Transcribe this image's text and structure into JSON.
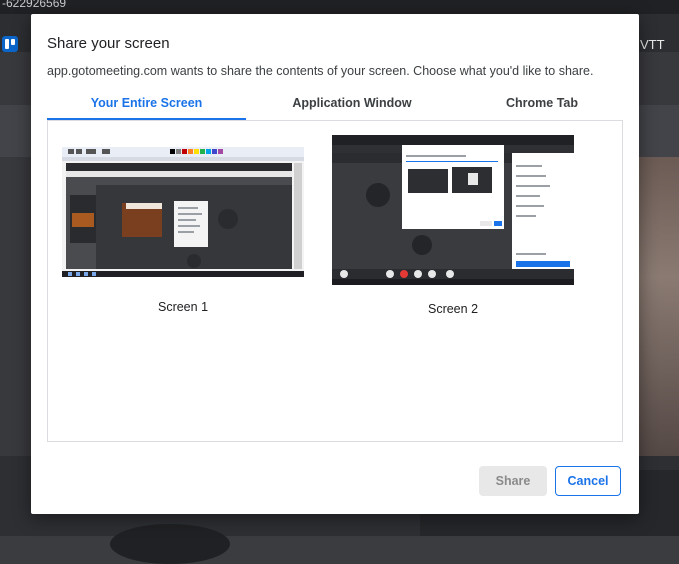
{
  "background": {
    "phone_text": "-622926569",
    "app_label": "VTT"
  },
  "dialog": {
    "title": "Share your screen",
    "subtitle": "app.gotomeeting.com wants to share the contents of your screen. Choose what you'd like to share.",
    "tabs": [
      {
        "label": "Your Entire Screen",
        "active": true
      },
      {
        "label": "Application Window",
        "active": false
      },
      {
        "label": "Chrome Tab",
        "active": false
      }
    ],
    "screens": [
      {
        "label": "Screen 1"
      },
      {
        "label": "Screen 2"
      }
    ],
    "share_label": "Share",
    "cancel_label": "Cancel"
  },
  "colors": {
    "accent": "#1a73e8",
    "disabled_bg": "#e8e8e8"
  }
}
